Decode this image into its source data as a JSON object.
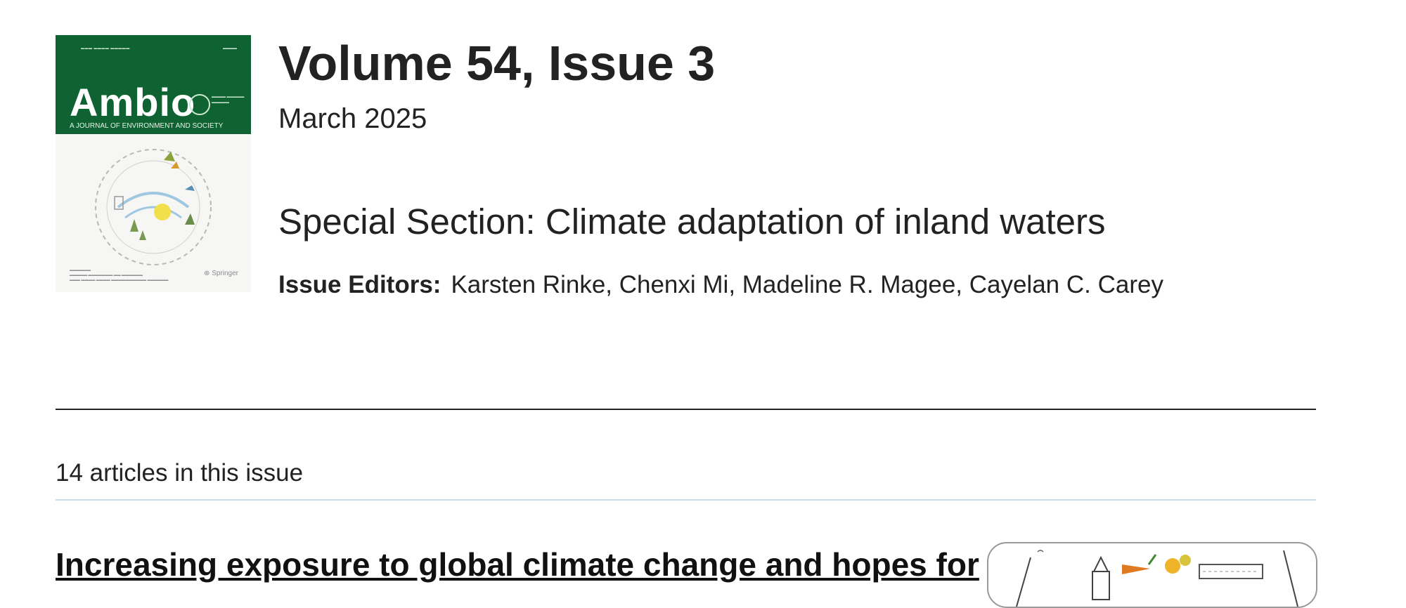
{
  "cover": {
    "journal_name": "Ambio",
    "subtitle": "A JOURNAL OF ENVIRONMENT AND SOCIETY",
    "publisher": "Springer",
    "band_color": "#0f6232"
  },
  "issue": {
    "title": "Volume 54, Issue 3",
    "date": "March 2025",
    "special_section": "Special Section: Climate adaptation of inland waters",
    "editors_label": "Issue Editors:",
    "editors": "Karsten Rinke, Chenxi Mi, Madeline R. Magee, Cayelan C. Carey"
  },
  "articles": {
    "count_text": "14 articles in this issue",
    "items": [
      {
        "title": "Increasing exposure to global climate change and hopes for"
      }
    ]
  }
}
